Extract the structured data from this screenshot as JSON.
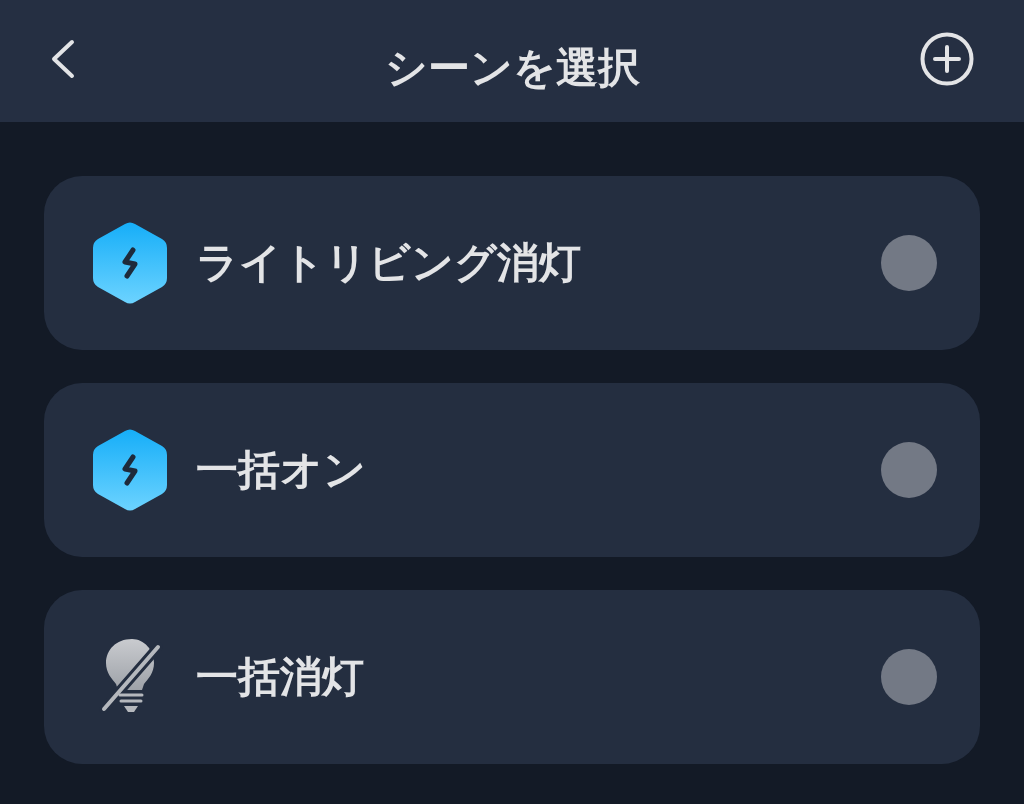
{
  "header": {
    "title": "シーンを選択"
  },
  "scenes": [
    {
      "name": "ライトリビング消灯",
      "kind": "scene",
      "selected": false
    },
    {
      "name": "一括オン",
      "kind": "scene",
      "selected": false
    },
    {
      "name": "一括消灯",
      "kind": "light-off",
      "selected": false
    }
  ]
}
